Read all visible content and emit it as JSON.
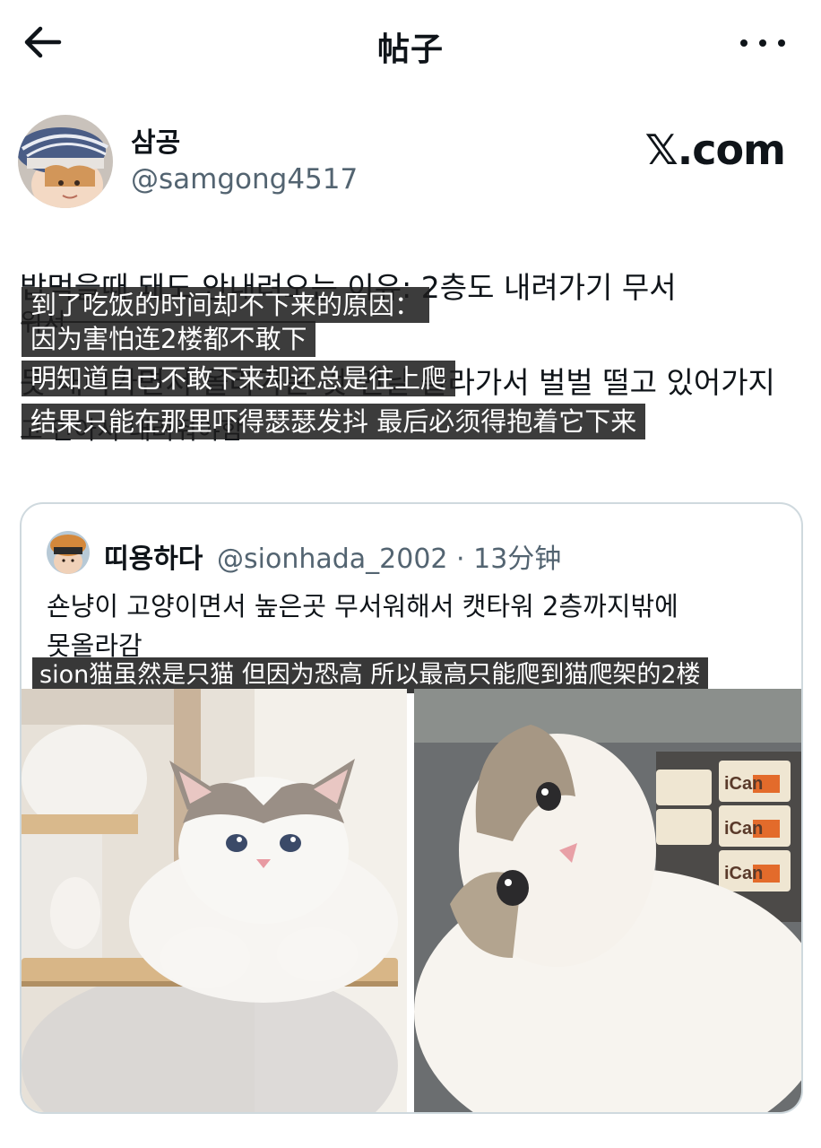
{
  "header": {
    "title": "帖子",
    "back_icon": "arrow-left-icon",
    "more_icon": "more-horizontal-icon"
  },
  "author": {
    "name": "삼공",
    "handle": "@samgong4517",
    "site": "𝕏.com"
  },
  "post": {
    "original_lines": [
      "밥먹을때 돼도 안내려오는 이유: 2층도 내려가기 무서",
      "워서",
      "못 내려가면서 올라가는 것 맨날 올라가서 벌벌 떨고 있어가지",
      "고 안아서 내려줘야함"
    ],
    "subtitles": [
      "到了吃饭的时间却不下来的原因：",
      "因为害怕连2楼都不敢下",
      "明知道自己不敢下来却还总是往上爬",
      "结果只能在那里吓得瑟瑟发抖 最后必须得抱着它下来"
    ]
  },
  "quote": {
    "name": "띠용하다",
    "handle_time": "@sionhada_2002 · 13分钟",
    "text_line1": "숀냥이 고양이면서 높은곳 무서워해서 캣타워 2층까지밖에",
    "text_line2": "못올라감",
    "subtitle": "sion猫虽然是只猫 但因为恐高 所以最高只能爬到猫爬架的2楼",
    "can_label": "iCan"
  },
  "colors": {
    "text": "#0f1419",
    "secondary": "#536471",
    "border": "#cfd9de",
    "subtitle_bg": "#1c1c1c"
  }
}
